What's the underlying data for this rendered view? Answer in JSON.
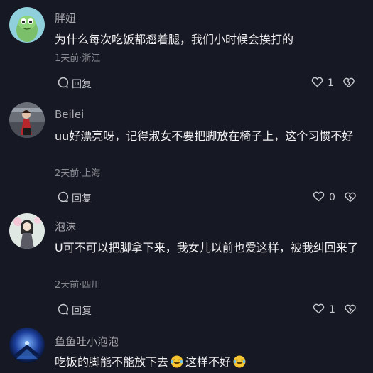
{
  "comments": [
    {
      "username": "胖妞",
      "text": "为什么每次吃饭都翘着腿，我们小时候会挨打的",
      "meta": "1天前·浙江",
      "reply_label": "回复",
      "like_count": "1"
    },
    {
      "username": "Beilei",
      "text": "uu好漂亮呀，记得淑女不要把脚放在椅子上，这个习惯不好",
      "meta": "2天前·上海",
      "reply_label": "回复",
      "like_count": "0"
    },
    {
      "username": "泡沫",
      "text": "U可不可以把脚拿下来，我女儿以前也爱这样，被我纠回来了",
      "meta": "2天前·四川",
      "reply_label": "回复",
      "like_count": "1"
    },
    {
      "username": "鱼鱼吐小泡泡",
      "text_part1": "吃饭的脚能不能放下去",
      "text_part2": "这样不好",
      "emoji": "laughing-with-tears"
    }
  ],
  "colors": {
    "background": "#161823",
    "text": "#f0f0f2",
    "muted": "#8a8b92"
  }
}
